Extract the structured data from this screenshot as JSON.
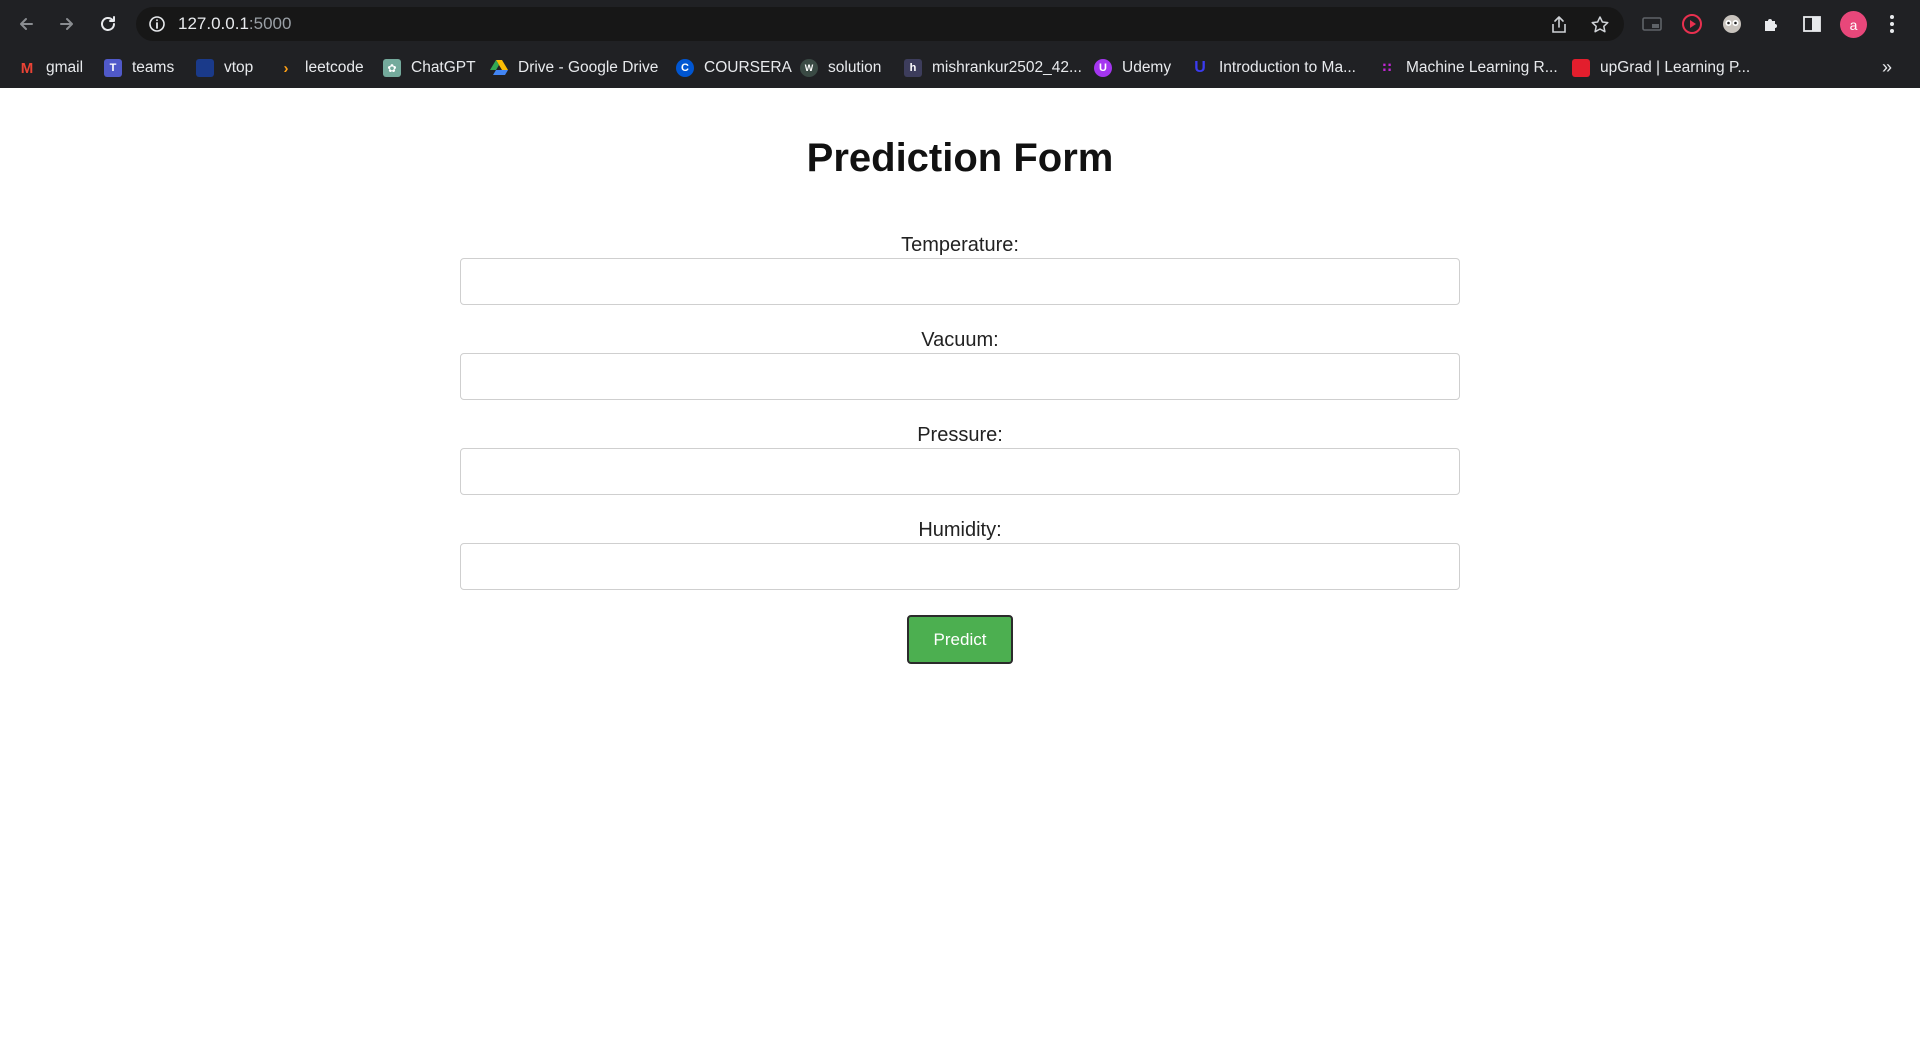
{
  "browser": {
    "url_host": "127.0.0.1",
    "url_port": ":5000",
    "avatar_letter": "a",
    "more_bookmarks": "»"
  },
  "bookmarks": [
    {
      "label": "gmail",
      "icon": "gmail-icon",
      "color": "#ea4335"
    },
    {
      "label": "teams",
      "icon": "teams-icon",
      "color": "#5059c9"
    },
    {
      "label": "vtop",
      "icon": "vtop-icon",
      "color": "#1a3a8a"
    },
    {
      "label": "leetcode",
      "icon": "leetcode-icon",
      "color": "#ffa116"
    },
    {
      "label": "ChatGPT",
      "icon": "chatgpt-icon",
      "color": "#74aa9c"
    },
    {
      "label": "Drive - Google Drive",
      "icon": "google-drive-icon",
      "color": "#34a853"
    },
    {
      "label": "COURSERA",
      "icon": "coursera-icon",
      "color": "#0056d2"
    },
    {
      "label": "solution",
      "icon": "solution-icon",
      "color": "#3a4a44"
    },
    {
      "label": "mishrankur2502_42...",
      "icon": "notion-icon",
      "color": "#3d3d5c"
    },
    {
      "label": "Udemy",
      "icon": "udemy-icon",
      "color": "#a435f0"
    },
    {
      "label": "Introduction to Ma...",
      "icon": "course-icon",
      "color": "#2b2bd6"
    },
    {
      "label": "Machine Learning R...",
      "icon": "ml-icon",
      "color": "#c026d3"
    },
    {
      "label": "upGrad | Learning P...",
      "icon": "upgrad-icon",
      "color": "#e31e2d"
    }
  ],
  "form": {
    "title": "Prediction Form",
    "fields": [
      {
        "label": "Temperature:",
        "value": ""
      },
      {
        "label": "Vacuum:",
        "value": ""
      },
      {
        "label": "Pressure:",
        "value": ""
      },
      {
        "label": "Humidity:",
        "value": ""
      }
    ],
    "submit_label": "Predict"
  },
  "colors": {
    "predict_button": "#4caf50",
    "chrome_bg": "#202124"
  }
}
